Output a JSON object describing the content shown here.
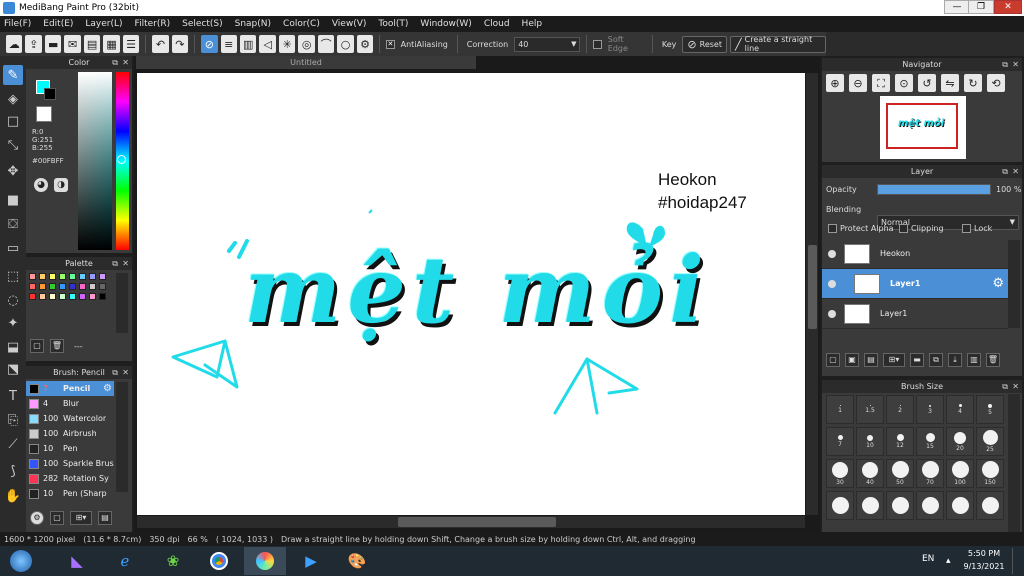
{
  "app": {
    "title": "MediBang Paint Pro (32bit)"
  },
  "window_controls": {
    "minimize": "—",
    "maximize": "❐",
    "close": "✕"
  },
  "menu": [
    "File(F)",
    "Edit(E)",
    "Layer(L)",
    "Filter(R)",
    "Select(S)",
    "Snap(N)",
    "Color(C)",
    "View(V)",
    "Tool(T)",
    "Window(W)",
    "Cloud",
    "Help"
  ],
  "toolbar": {
    "antialiasing_label": "AntiAliasing",
    "correction_label": "Correction",
    "correction_value": "40",
    "soft_edge_label": "Soft Edge",
    "key_label": "Key",
    "reset_label": "Reset",
    "straight_line_label": "Create a straight line"
  },
  "color_panel": {
    "title": "Color",
    "r": "R:0",
    "g": "G:251",
    "b": "B:255",
    "hex": "#00FBFF",
    "fg_color": "#00fbff",
    "bg_color": "#000000"
  },
  "palette_panel": {
    "title": "Palette",
    "colors": [
      "#ff9999",
      "#ffcc66",
      "#ffff66",
      "#99ff66",
      "#66ff99",
      "#66ccff",
      "#9999ff",
      "#cc99ff",
      "#ff6666",
      "#ff9933",
      "#33cc33",
      "#3399ff",
      "#3333cc",
      "#ff66cc",
      "#cccccc",
      "#666666",
      "#ff3333",
      "#ffcc99",
      "#ffffcc",
      "#ccffcc",
      "#33ffff",
      "#cc66ff",
      "#ff99cc",
      "#000000"
    ],
    "dash": "---"
  },
  "brush_panel": {
    "title": "Brush: Pencil",
    "items": [
      {
        "size": "7",
        "name": "Pencil",
        "color": "#000000",
        "selected": true
      },
      {
        "size": "4",
        "name": "Blur",
        "color": "#ff99ff",
        "selected": false
      },
      {
        "size": "100",
        "name": "Watercolor",
        "color": "#88ddff",
        "selected": false
      },
      {
        "size": "100",
        "name": "Airbrush",
        "color": "#cccccc",
        "selected": false
      },
      {
        "size": "10",
        "name": "Pen",
        "color": "#222222",
        "selected": false
      },
      {
        "size": "100",
        "name": "Sparkle Brus",
        "color": "#3355ff",
        "selected": false
      },
      {
        "size": "282",
        "name": "Rotation Sy",
        "color": "#ff3355",
        "selected": false
      },
      {
        "size": "10",
        "name": "Pen (Sharp",
        "color": "#222222",
        "selected": false
      }
    ]
  },
  "document": {
    "tab": "Untitled"
  },
  "artwork": {
    "text_line1": "Heokon",
    "text_line2": "#hoidap247",
    "lettering": "mệt mỏi",
    "accent": "#22dbe9"
  },
  "navigator": {
    "title": "Navigator"
  },
  "layer_panel": {
    "title": "Layer",
    "opacity_label": "Opacity",
    "opacity_value": "100 %",
    "opacity": 1.0,
    "blending_label": "Blending",
    "blending_value": "Normal",
    "protect_alpha": "Protect Alpha",
    "clipping": "Clipping",
    "lock": "Lock",
    "layers": [
      {
        "name": "Heokon",
        "selected": false
      },
      {
        "name": "Layer1",
        "selected": true
      },
      {
        "name": "Layer1",
        "selected": false
      }
    ]
  },
  "brush_size_panel": {
    "title": "Brush Size",
    "sizes": [
      "1",
      "1.5",
      "2",
      "3",
      "4",
      "5",
      "7",
      "10",
      "12",
      "15",
      "20",
      "25",
      "30",
      "40",
      "50",
      "70",
      "100",
      "150",
      "",
      "",
      "",
      "",
      "",
      ""
    ]
  },
  "status": {
    "pixels": "1600 * 1200 pixel",
    "cm": "(11.6 * 8.7cm)",
    "dpi": "350 dpi",
    "zoom": "66 %",
    "coords": "( 1024, 1033 )",
    "hint": "Draw a straight line by holding down Shift, Change a brush size by holding down Ctrl, Alt, and dragging"
  },
  "taskbar": {
    "lang": "EN",
    "time": "5:50 PM",
    "date": "9/13/2021"
  }
}
